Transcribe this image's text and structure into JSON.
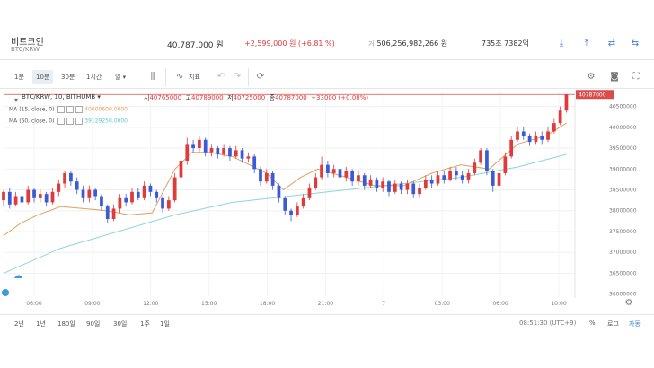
{
  "header": {
    "coin_name": "비트코인",
    "coin_pair": "BTC/KRW",
    "price": "40,787,000 원",
    "change": "+2,599,000 원 (+6.81 %)",
    "volume_label": "거",
    "volume": "506,256,982,266 원",
    "market_cap": "735조 7382억"
  },
  "toolbar": {
    "intervals": [
      "1분",
      "10분",
      "30분",
      "1시간",
      "일"
    ],
    "active_interval": "10분",
    "indicator_label": "지표"
  },
  "legend": {
    "title": "BTC/KRW, 10, BITHUMB",
    "open_label": "시",
    "open": "40765000",
    "high_label": "고",
    "high": "40789000",
    "low_label": "저",
    "low": "40725000",
    "close_label": "종",
    "close": "40787000",
    "change": "+33000 (+0.08%)",
    "ma1_label": "MA (15, close, 0)",
    "ma1_value": "40000600.0000",
    "ma2_label": "MA (60, close, 0)",
    "ma2_value": "39129250.0000"
  },
  "bottom": {
    "ranges": [
      "2년",
      "1년",
      "180일",
      "90일",
      "30일",
      "1주",
      "1일"
    ],
    "clock": "08:51:30 (UTC+9)",
    "percent": "%",
    "log": "로그",
    "auto": "자동"
  },
  "colors": {
    "up": "#e03a3a",
    "down": "#3b5bd6",
    "ma1": "#e0a060",
    "ma2": "#8fd6d8",
    "last_price": "#d94c4c"
  },
  "chart_data": {
    "type": "candlestick",
    "x_ticks": [
      "06:00",
      "09:00",
      "12:00",
      "15:00",
      "18:00",
      "21:00",
      "7",
      "03:00",
      "06:00",
      "10:00"
    ],
    "y_ticks": [
      36000000,
      36500000,
      37000000,
      37500000,
      38000000,
      38500000,
      39000000,
      39500000,
      40000000,
      40500000
    ],
    "ylim": [
      35950000,
      40900000
    ],
    "last_price": 40787000,
    "ma15_path": [
      [
        0,
        37400000
      ],
      [
        0.03,
        37700000
      ],
      [
        0.06,
        37900000
      ],
      [
        0.1,
        38100000
      ],
      [
        0.14,
        38050000
      ],
      [
        0.18,
        38000000
      ],
      [
        0.22,
        37900000
      ],
      [
        0.26,
        37950000
      ],
      [
        0.3,
        39000000
      ],
      [
        0.33,
        39400000
      ],
      [
        0.36,
        39400000
      ],
      [
        0.4,
        39300000
      ],
      [
        0.43,
        39100000
      ],
      [
        0.46,
        38900000
      ],
      [
        0.49,
        38500000
      ],
      [
        0.52,
        38800000
      ],
      [
        0.55,
        39000000
      ],
      [
        0.6,
        38800000
      ],
      [
        0.65,
        38600000
      ],
      [
        0.7,
        38600000
      ],
      [
        0.75,
        38900000
      ],
      [
        0.8,
        39100000
      ],
      [
        0.85,
        39000000
      ],
      [
        0.9,
        39600000
      ],
      [
        0.95,
        39800000
      ],
      [
        0.985,
        40100000
      ]
    ],
    "ma60_path": [
      [
        0,
        36500000
      ],
      [
        0.1,
        37100000
      ],
      [
        0.2,
        37500000
      ],
      [
        0.3,
        37900000
      ],
      [
        0.4,
        38200000
      ],
      [
        0.5,
        38350000
      ],
      [
        0.6,
        38500000
      ],
      [
        0.7,
        38650000
      ],
      [
        0.8,
        38800000
      ],
      [
        0.9,
        39050000
      ],
      [
        0.985,
        39350000
      ]
    ],
    "candles": [
      [
        38250000,
        38450000,
        38100000,
        38500000
      ],
      [
        38450000,
        38150000,
        38050000,
        38550000
      ],
      [
        38150000,
        38350000,
        38100000,
        38450000
      ],
      [
        38350000,
        38200000,
        38050000,
        38450000
      ],
      [
        38200000,
        38500000,
        38150000,
        38600000
      ],
      [
        38500000,
        38300000,
        38200000,
        38550000
      ],
      [
        38300000,
        38400000,
        38200000,
        38500000
      ],
      [
        38400000,
        38200000,
        38100000,
        38450000
      ],
      [
        38200000,
        38450000,
        38150000,
        38550000
      ],
      [
        38450000,
        38650000,
        38350000,
        38750000
      ],
      [
        38650000,
        38900000,
        38550000,
        38950000
      ],
      [
        38900000,
        38700000,
        38600000,
        38950000
      ],
      [
        38700000,
        38500000,
        38400000,
        38800000
      ],
      [
        38500000,
        38300000,
        38200000,
        38600000
      ],
      [
        38300000,
        38500000,
        38200000,
        38600000
      ],
      [
        38500000,
        38350000,
        38250000,
        38550000
      ],
      [
        38350000,
        38100000,
        38000000,
        38400000
      ],
      [
        38100000,
        37800000,
        37700000,
        38150000
      ],
      [
        37800000,
        38050000,
        37750000,
        38150000
      ],
      [
        38050000,
        38300000,
        37950000,
        38400000
      ],
      [
        38300000,
        38200000,
        38100000,
        38400000
      ],
      [
        38200000,
        38450000,
        38150000,
        38550000
      ],
      [
        38450000,
        38300000,
        38250000,
        38550000
      ],
      [
        38300000,
        38600000,
        38250000,
        38700000
      ],
      [
        38600000,
        38450000,
        38350000,
        38650000
      ],
      [
        38450000,
        38300000,
        38200000,
        38500000
      ],
      [
        38300000,
        38050000,
        37950000,
        38350000
      ],
      [
        38050000,
        38250000,
        38000000,
        38350000
      ],
      [
        38250000,
        38800000,
        38200000,
        38900000
      ],
      [
        38800000,
        39200000,
        38700000,
        39300000
      ],
      [
        39200000,
        39600000,
        39100000,
        39750000
      ],
      [
        39600000,
        39500000,
        39400000,
        39700000
      ],
      [
        39500000,
        39700000,
        39400000,
        39800000
      ],
      [
        39700000,
        39400000,
        39300000,
        39750000
      ],
      [
        39400000,
        39500000,
        39300000,
        39600000
      ],
      [
        39500000,
        39350000,
        39250000,
        39550000
      ],
      [
        39350000,
        39500000,
        39300000,
        39600000
      ],
      [
        39500000,
        39300000,
        39200000,
        39550000
      ],
      [
        39300000,
        39450000,
        39250000,
        39550000
      ],
      [
        39450000,
        39250000,
        39150000,
        39500000
      ],
      [
        39250000,
        39300000,
        39150000,
        39400000
      ],
      [
        39300000,
        39000000,
        38900000,
        39350000
      ],
      [
        39000000,
        38700000,
        38600000,
        39050000
      ],
      [
        38700000,
        38900000,
        38650000,
        39000000
      ],
      [
        38900000,
        38600000,
        38500000,
        38950000
      ],
      [
        38600000,
        38300000,
        38200000,
        38650000
      ],
      [
        38300000,
        38000000,
        37900000,
        38350000
      ],
      [
        38000000,
        37900000,
        37750000,
        38050000
      ],
      [
        37900000,
        38100000,
        37850000,
        38200000
      ],
      [
        38100000,
        38300000,
        38050000,
        38400000
      ],
      [
        38300000,
        38550000,
        38250000,
        38650000
      ],
      [
        38550000,
        38800000,
        38500000,
        38900000
      ],
      [
        38800000,
        39100000,
        38750000,
        39300000
      ],
      [
        39100000,
        38900000,
        38800000,
        39200000
      ],
      [
        38900000,
        39000000,
        38800000,
        39100000
      ],
      [
        39000000,
        38800000,
        38700000,
        39050000
      ],
      [
        38800000,
        38950000,
        38700000,
        39050000
      ],
      [
        38950000,
        38700000,
        38600000,
        39000000
      ],
      [
        38700000,
        38850000,
        38600000,
        38950000
      ],
      [
        38850000,
        38600000,
        38500000,
        38900000
      ],
      [
        38600000,
        38750000,
        38550000,
        38850000
      ],
      [
        38750000,
        38550000,
        38450000,
        38800000
      ],
      [
        38550000,
        38700000,
        38450000,
        38800000
      ],
      [
        38700000,
        38450000,
        38350000,
        38750000
      ],
      [
        38450000,
        38650000,
        38400000,
        38750000
      ],
      [
        38650000,
        38500000,
        38400000,
        38700000
      ],
      [
        38500000,
        38650000,
        38400000,
        38750000
      ],
      [
        38650000,
        38400000,
        38300000,
        38700000
      ],
      [
        38400000,
        38550000,
        38300000,
        38650000
      ],
      [
        38550000,
        38750000,
        38500000,
        38850000
      ],
      [
        38750000,
        38650000,
        38550000,
        38850000
      ],
      [
        38650000,
        38850000,
        38600000,
        38950000
      ],
      [
        38850000,
        38750000,
        38650000,
        38950000
      ],
      [
        38750000,
        38950000,
        38700000,
        39050000
      ],
      [
        38950000,
        38850000,
        38750000,
        39050000
      ],
      [
        38850000,
        38750000,
        38650000,
        38950000
      ],
      [
        38750000,
        38900000,
        38650000,
        39000000
      ],
      [
        38900000,
        39150000,
        38850000,
        39250000
      ],
      [
        39150000,
        39450000,
        39100000,
        39500000
      ],
      [
        39450000,
        38950000,
        38850000,
        39500000
      ],
      [
        38950000,
        38600000,
        38450000,
        39000000
      ],
      [
        38600000,
        38900000,
        38550000,
        39000000
      ],
      [
        38900000,
        39300000,
        38850000,
        39400000
      ],
      [
        39300000,
        39700000,
        39250000,
        39800000
      ],
      [
        39700000,
        39900000,
        39650000,
        40000000
      ],
      [
        39900000,
        39800000,
        39700000,
        40000000
      ],
      [
        39800000,
        39650000,
        39550000,
        39850000
      ],
      [
        39650000,
        39800000,
        39600000,
        39900000
      ],
      [
        39800000,
        39700000,
        39600000,
        39900000
      ],
      [
        39700000,
        39900000,
        39650000,
        40000000
      ],
      [
        39900000,
        40100000,
        39850000,
        40200000
      ],
      [
        40100000,
        40400000,
        40050000,
        40500000
      ],
      [
        40400000,
        40787000,
        40350000,
        40790000
      ]
    ]
  }
}
